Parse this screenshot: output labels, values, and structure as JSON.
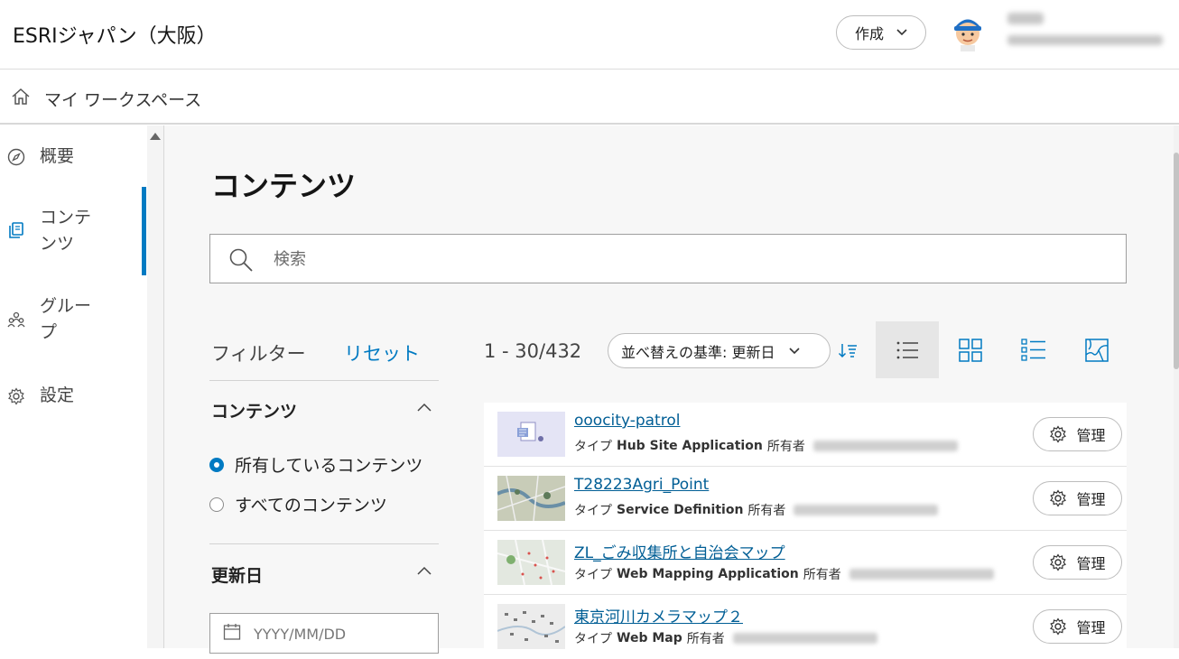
{
  "header": {
    "org_name": "ESRIジャパン（大阪）",
    "create_label": "作成"
  },
  "breadcrumb": {
    "label": "マイ ワークスペース"
  },
  "sidebar": {
    "items": [
      {
        "label": "概要",
        "icon": "compass-icon"
      },
      {
        "label": "コンテンツ",
        "icon": "content-icon",
        "active": true
      },
      {
        "label": "グループ",
        "icon": "group-icon"
      },
      {
        "label": "設定",
        "icon": "gear-icon"
      }
    ]
  },
  "main": {
    "title": "コンテンツ",
    "search_placeholder": "検索",
    "filter": {
      "heading": "フィルター",
      "reset_label": "リセット",
      "content_section": {
        "title": "コンテンツ",
        "options": [
          {
            "label": "所有しているコンテンツ",
            "selected": true
          },
          {
            "label": "すべてのコンテンツ",
            "selected": false
          }
        ]
      },
      "modified_section": {
        "title": "更新日",
        "date_placeholder": "YYYY/MM/DD"
      }
    },
    "results": {
      "count": "1 - 30/432",
      "sort_label": "並べ替えの基準: 更新日",
      "active_view": "list"
    },
    "items": [
      {
        "title": "ooocity-patrol",
        "type_label": "タイプ",
        "type": "Hub Site Application",
        "owner_label": "所有者"
      },
      {
        "title": "T28223Agri_Point",
        "type_label": "タイプ",
        "type": "Service Definition",
        "owner_label": "所有者"
      },
      {
        "title": "ZL_ごみ収集所と自治会マップ",
        "type_label": "タイプ",
        "type": "Web Mapping Application",
        "owner_label": "所有者"
      },
      {
        "title": "東京河川カメラマップ２",
        "type_label": "タイプ",
        "type": "Web Map",
        "owner_label": "所有者"
      }
    ],
    "manage_label": "管理"
  },
  "colors": {
    "accent": "#007ac2",
    "link": "#005e95"
  }
}
